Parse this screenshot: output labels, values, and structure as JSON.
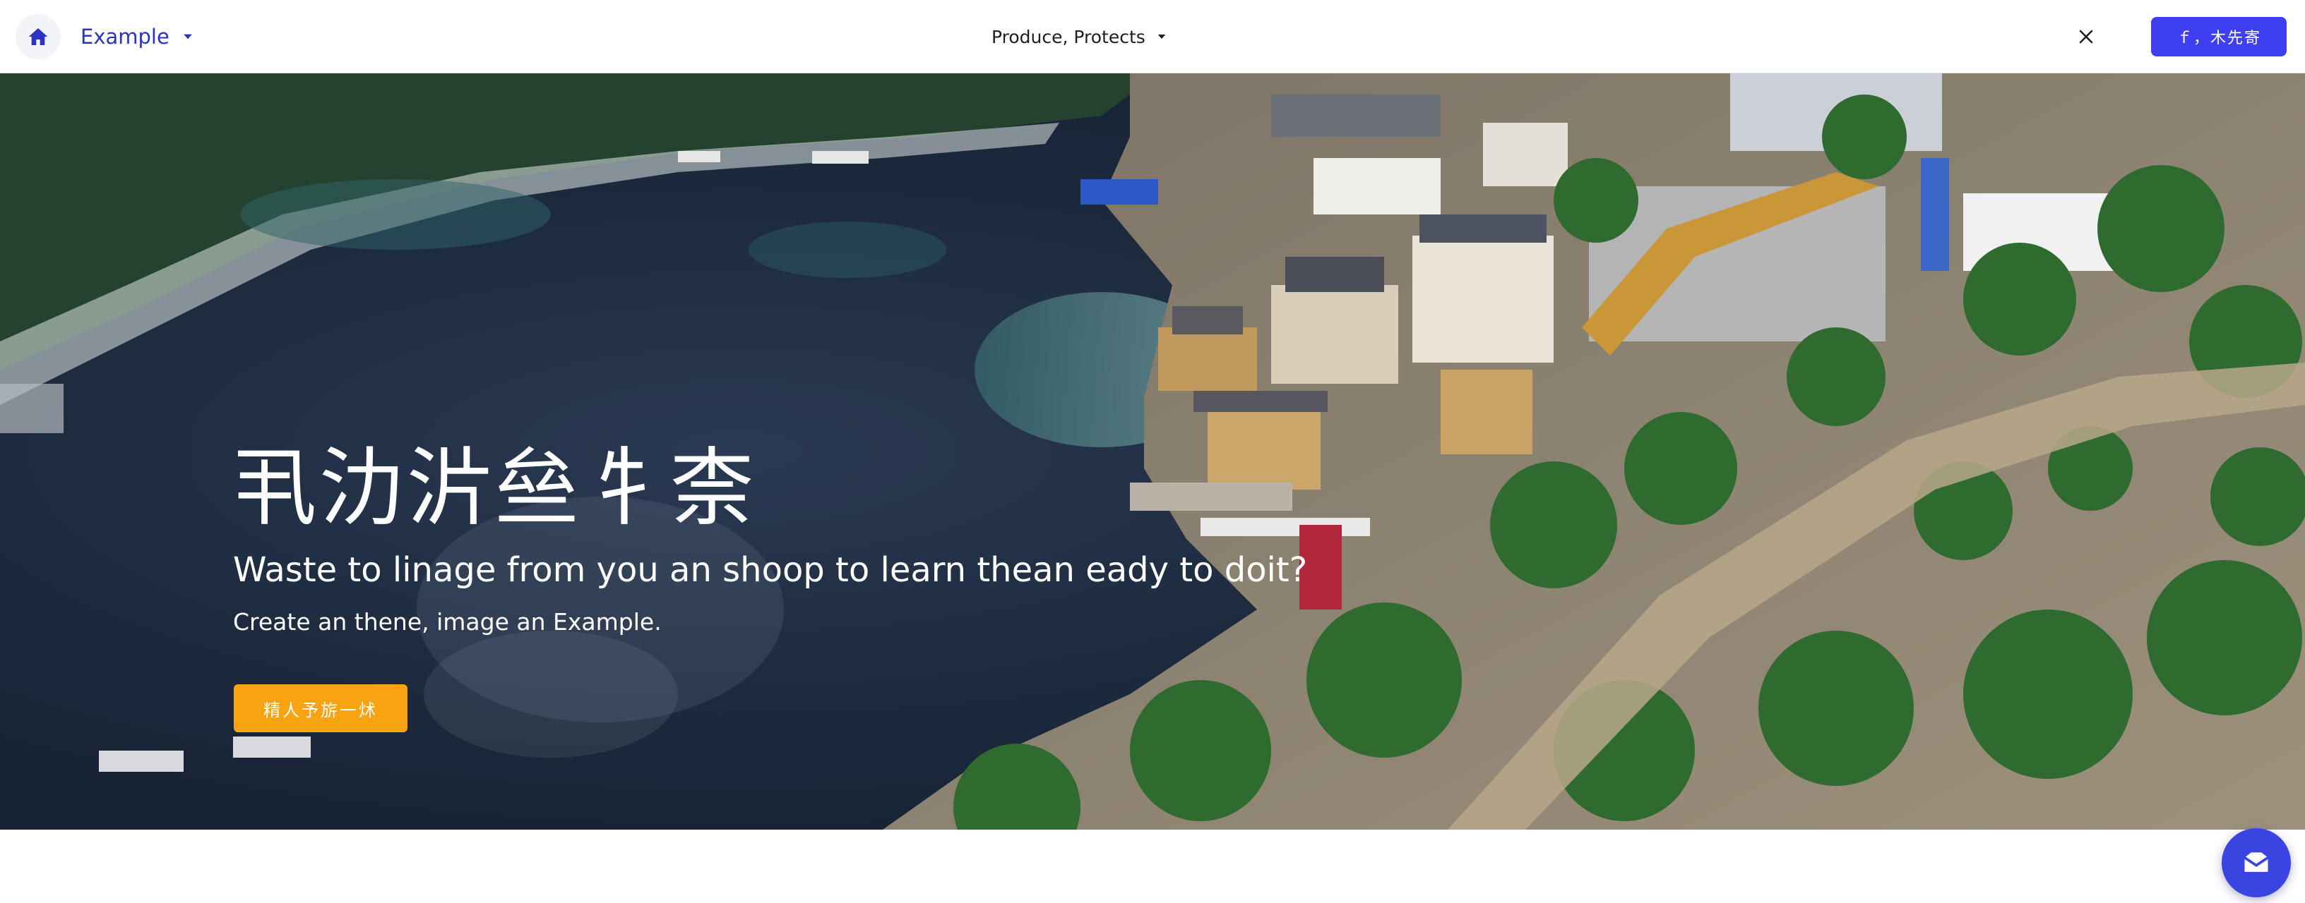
{
  "nav": {
    "home_icon": "home-icon",
    "brand_label": "Example",
    "brand_caret_icon": "chevron-down-icon",
    "center_menu_label": "Produce, Protects",
    "center_caret_icon": "chevron-down-icon",
    "close_icon": "close-icon",
    "cta_label": "ｆ，木先寄"
  },
  "hero": {
    "title": "丮氻沜亝牜柰",
    "subtitle": "Waste to linage from you an shoop to learn thean eady to doit?",
    "tagline": "Create an thene, image an Example.",
    "cta_label": "精人予旂一炢",
    "background": "aerial-harbor-town-photo"
  },
  "chat": {
    "icon": "chat-icon"
  },
  "colors": {
    "accent": "#3d3ff0",
    "brand_text": "#2a33c4",
    "cta_orange": "#f7a312"
  }
}
